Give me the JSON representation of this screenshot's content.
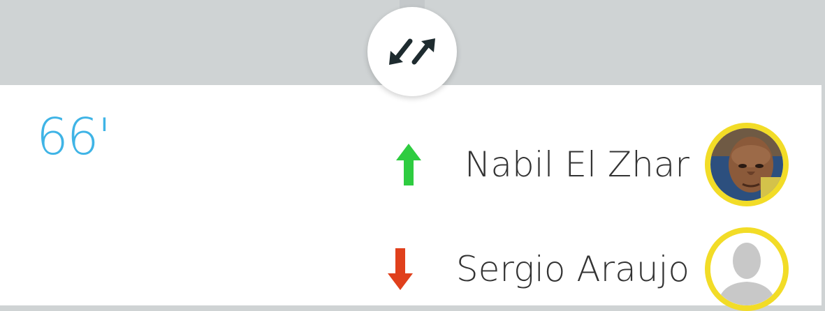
{
  "event": {
    "icon": "substitution-swap-icon",
    "minute": "66'"
  },
  "players": [
    {
      "name": "Nabil El Zhar",
      "direction": "in",
      "arrow_icon": "arrow-up-icon",
      "arrow_color": "#2ecc40",
      "avatar": "player-photo-avatar"
    },
    {
      "name": "Sergio Araujo",
      "direction": "out",
      "arrow_icon": "arrow-down-icon",
      "arrow_color": "#e0401c",
      "avatar": "placeholder-silhouette-avatar"
    }
  ],
  "colors": {
    "minute": "#3fb4e6",
    "avatar_ring": "#f2dc27",
    "background": "#cfd3d4"
  }
}
